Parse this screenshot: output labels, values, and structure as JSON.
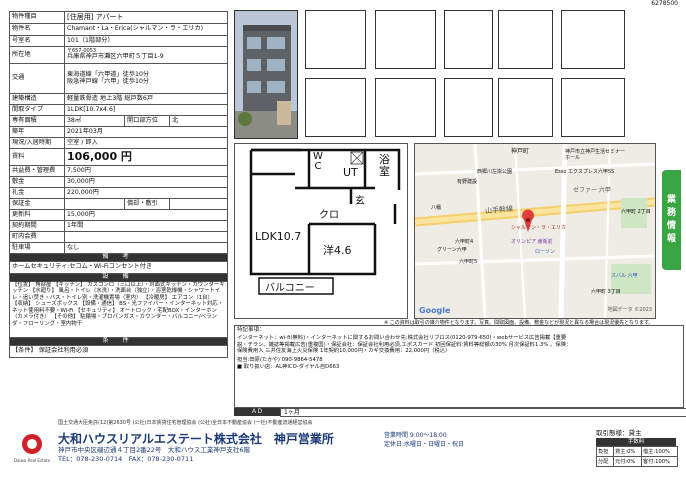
{
  "doc_id": "6278500",
  "spec": {
    "type_label": "物件種目",
    "type_value": "[住居用] アパート",
    "name_label": "物件名",
    "name_value": "Chamant・La・Erica(シャルマン・ラ・エリカ)",
    "room_label": "号室名",
    "room_value": "101（1階部分）",
    "address_label": "所在地",
    "postal": "〒657-0053",
    "address_value": "兵庫県神戸市灘区六甲町５丁目1-9",
    "traffic_label": "交通",
    "traffic_line1": "東海道線「六甲道」徒歩10分",
    "traffic_line2": "阪急神戸線「六甲」徒歩10分",
    "structure_label": "建築構造",
    "structure_value": "軽量鉄骨造 地上3階 総戸数6戸",
    "layout_label": "間取タイプ",
    "layout_value": "1LDK[10.7x4.6]",
    "area_label": "専有面積",
    "area_value": "38㎡",
    "direction_label": "開口部方位",
    "direction_value": "北",
    "built_label": "築年",
    "built_value": "2021年03月",
    "status_label": "現況/入居時期",
    "status_value": "空室 / 即入",
    "rent_label": "賃料",
    "rent_value": "106,000 円",
    "mgmt_label": "共益費・管理費",
    "mgmt_value": "7,500円",
    "shikikin_label": "敷金",
    "shikikin_value": "30,000円",
    "reikin_label": "礼金",
    "reikin_value": "220,000円",
    "hoshokin_label": "保証金",
    "kyakubiki_label": "償却・敷引",
    "koshin_label": "更新料",
    "koshin_value": "15,000円",
    "keiyaku_label": "契約期間",
    "keiyaku_value": "1年間",
    "naikai_label": "町内会費",
    "naikai_value": "",
    "parking_label": "駐車場",
    "parking_value": "なし"
  },
  "remarks_header": "備 考",
  "remarks_text": "ホームセキュリティ:セコム・Wi-Fiコンセント付き",
  "equipment_header": "設 備",
  "equipment_text": "【位置】 角部屋 【キッチン】 ガスコンロ（三口以上）・対面式キッチン・カウンターキッチン 【水廻り】 風呂・トイレ（水洗）・洗面台（独立）・浴室乾燥機・シャワートイレ・追い焚き・バス・トイレ別・洗濯機置場（室内） 【冷暖房】 エアコン（1台） 【収納】 シューズボックス 【設備・通信】 BS・光ファイバー・インターネット対応・ネット使用料不要・Wi-Fi 【セキュリティ】 オートロック・宅配BOX・インターホン（カメラ付き） 【その他】 駐輪場・プロパンガス・カウンター・バルコニー/ベランダ・フローリング・室内物干",
  "conditions_header": "条 件",
  "conditions_text": "【条件】 保証会社利用必須",
  "floorplan": {
    "wc": "W\nC",
    "ut": "UT",
    "bath": "浴\n室",
    "cl": "クロ",
    "gen": "玄",
    "ldk": "LDK10.7",
    "western": "洋4.6",
    "balcony": "バルコニー"
  },
  "map": {
    "labels": [
      "神戸町",
      "神戸市立神戸生活セミナーホール",
      "西郷川左岸公園",
      "Esso エクスプレス六甲SS",
      "ゼファー 六甲",
      "有野建設",
      "山手幹線",
      "八幡",
      "六甲町4",
      "六甲町5",
      "オリンピア 番衛前",
      "シャルマン・ラ・エリカ",
      "グリーン六甲",
      "ローソン",
      "スバル 六甲",
      "六甲町 3丁目",
      "六甲町 2丁目"
    ],
    "google": "Google",
    "credit": "地図データ ©2023"
  },
  "notice": "※ この資料は取引の媒介物件となります。写真、間取図面、設備、敷金などが現況と異なる場合は現況優先となります。",
  "notes": {
    "header": "特記事項：",
    "line1": "インターネット：wi-fi(無料)・インターネットに関するお問い合わせ先:株式会社リブロス(0120-979-650)・webサービス広告掲載【重要説・チラシ、雑誌等掲載広告(重複国)・保証会社：保証会社利用必須,エポスカード 初回保証料:賃料等総額の30% 月次保証料1.3% 。保険：保険費用入 三井住友海上火災保険 1年契約10,000円・カギ交換費用：22,000円（税込）",
    "line2": "担当:田原(たかや) 090-9864-5478",
    "line3": "■ 取り扱い店：AL神ICO-ダイヤル自D663"
  },
  "ad": {
    "label": "ＡＤ",
    "value": "1ヶ月"
  },
  "footer": {
    "license": "国土交通大臣免許(12)第2630号 (公社)日本賃貸住宅管理協会 (公社)全日本不動産協会 (一社)不動産流通経営協会",
    "company": "大和ハウスリアルエステート株式会社　神戸営業所",
    "address": "神戸市中央区磯辺通４丁目2番22号　大和ハウス工業神戸支社6階",
    "tel": "TEL：078-230-0714　FAX：078-230-0711",
    "logo_text": "Daiwa Real Estate",
    "hours": "営業時間 9:00～18:00",
    "holidays": "定休日:水曜日・日曜日・祝日",
    "deal_title": "取引態様：貸主",
    "fee_header": "手数料",
    "fee_rows": [
      [
        "負担",
        "貸主:0%",
        "借主:100%"
      ],
      [
        "分配",
        "元付:0%",
        "客付:100%"
      ]
    ]
  },
  "side_tab": [
    "業",
    "務",
    "情",
    "報"
  ]
}
